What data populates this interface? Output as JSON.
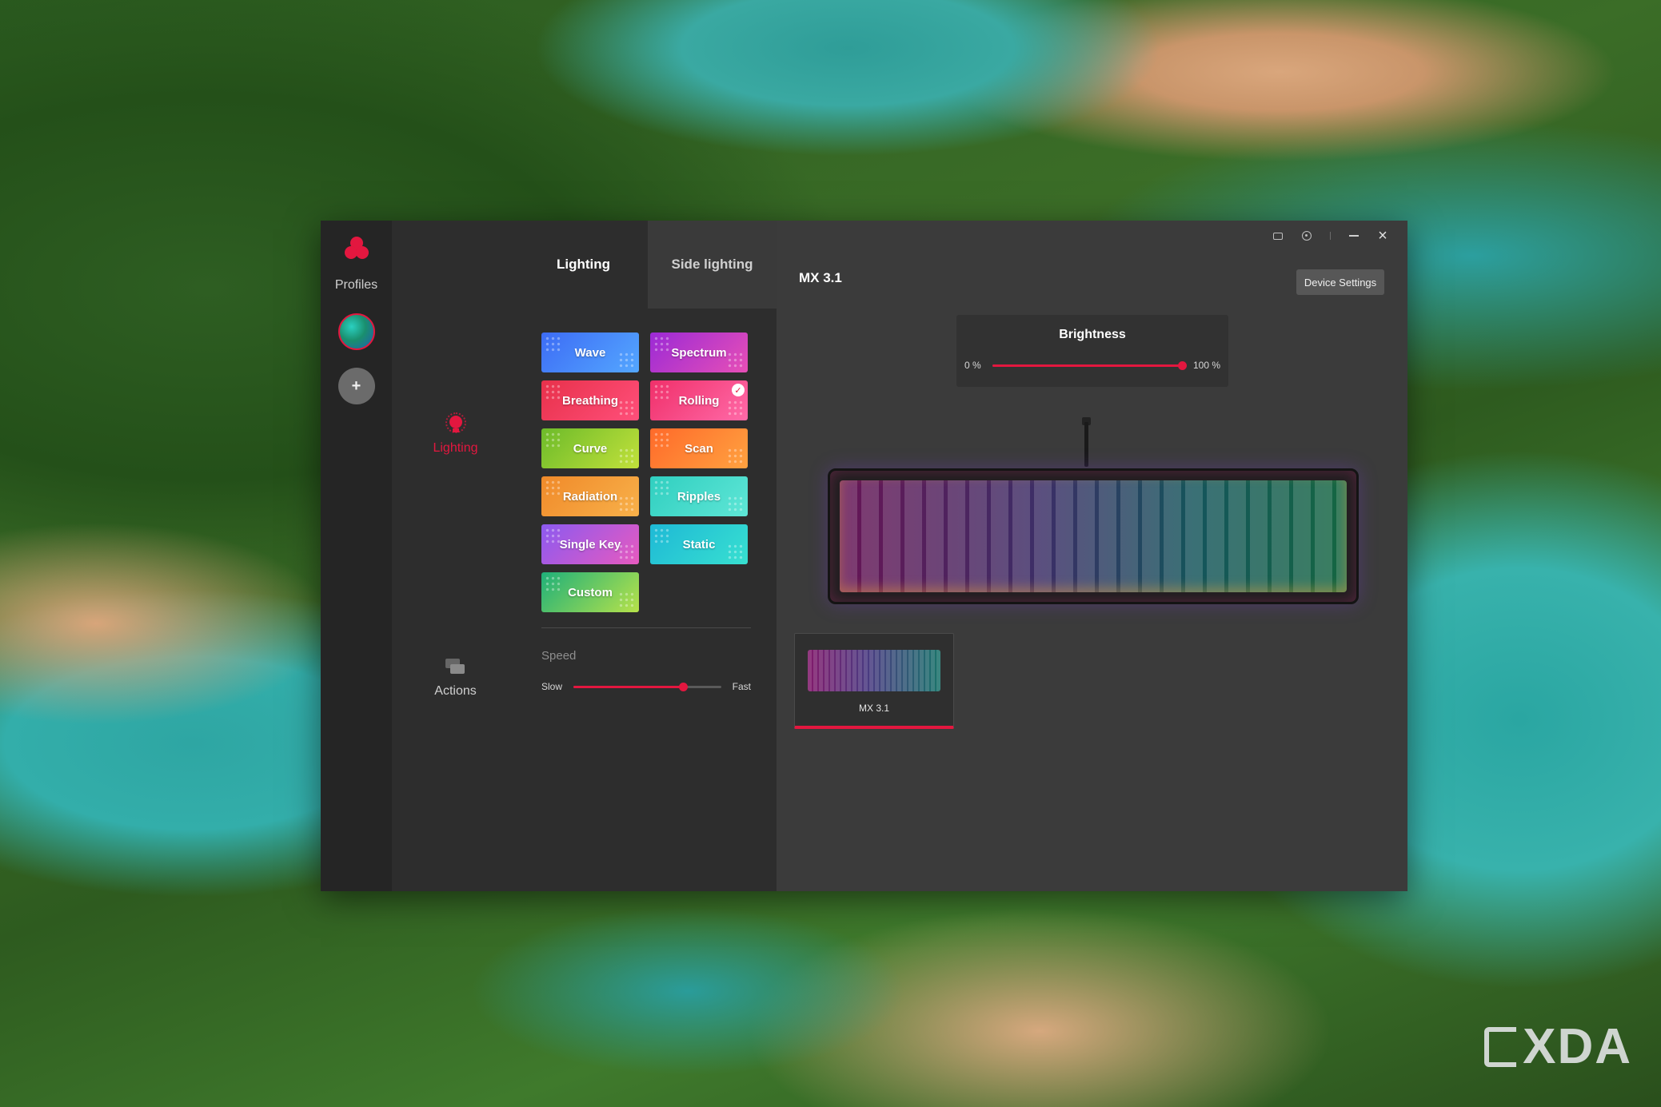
{
  "sidebar": {
    "profiles_label": "Profiles",
    "add_label": "+"
  },
  "nav": {
    "lighting_label": "Lighting",
    "actions_label": "Actions"
  },
  "tabs": [
    {
      "label": "Lighting"
    },
    {
      "label": "Side lighting"
    }
  ],
  "effects": [
    {
      "label": "Wave",
      "bg": "linear-gradient(135deg,#3d6cf5,#54a7ff)"
    },
    {
      "label": "Spectrum",
      "bg": "linear-gradient(135deg,#9b2ad6,#e74fb6)"
    },
    {
      "label": "Breathing",
      "bg": "linear-gradient(135deg,#e8314b,#ff4f7a)"
    },
    {
      "label": "Rolling",
      "bg": "linear-gradient(135deg,#f0306a,#ff6aa8)",
      "selected": true
    },
    {
      "label": "Curve",
      "bg": "linear-gradient(135deg,#6dbb2a,#c2e13b)"
    },
    {
      "label": "Scan",
      "bg": "linear-gradient(135deg,#ff6a2a,#ffa240)"
    },
    {
      "label": "Radiation",
      "bg": "linear-gradient(135deg,#f08a2a,#f8b14a)"
    },
    {
      "label": "Ripples",
      "bg": "linear-gradient(135deg,#30cfc0,#5fe6d6)"
    },
    {
      "label": "Single Key",
      "bg": "linear-gradient(135deg,#8c5af0,#e75abf)"
    },
    {
      "label": "Static",
      "bg": "linear-gradient(135deg,#1eb9d6,#38e0d0)"
    },
    {
      "label": "Custom",
      "bg": "linear-gradient(135deg,#1fb07a,#b7e24a)"
    }
  ],
  "speed": {
    "title": "Speed",
    "min_label": "Slow",
    "max_label": "Fast",
    "value_percent": 74
  },
  "main": {
    "device_title": "MX 3.1",
    "device_settings_label": "Device Settings",
    "brightness": {
      "title": "Brightness",
      "min_label": "0 %",
      "max_label": "100 %",
      "value_percent": 100
    },
    "device_thumb_label": "MX 3.1"
  },
  "icons": {
    "logo": "cherry-logo-icon",
    "lighting": "bulb-icon",
    "actions": "layers-icon",
    "feedback": "feedback-icon",
    "settings": "settings-icon",
    "minimize": "minimize-icon",
    "close": "close-icon"
  },
  "colors": {
    "accent": "#e3173f",
    "window_bg": "#3b3b3b",
    "sidebar_bg": "#252525",
    "panel_bg": "#2d2d2d"
  },
  "watermark": "XDA"
}
